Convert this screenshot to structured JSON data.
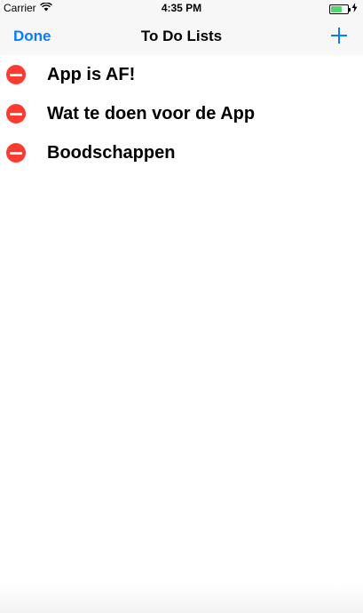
{
  "status_bar": {
    "carrier": "Carrier",
    "time": "4:35 PM",
    "battery_level": 0.65,
    "battery_color": "#4cd964"
  },
  "nav": {
    "done_label": "Done",
    "title": "To Do Lists",
    "add_icon": "plus-icon",
    "accent": "#0a7aff"
  },
  "lists": [
    {
      "label": "App is AF!"
    },
    {
      "label": "Wat te doen voor de App"
    },
    {
      "label": "Boodschappen"
    }
  ],
  "delete_color": "#fe3b30"
}
